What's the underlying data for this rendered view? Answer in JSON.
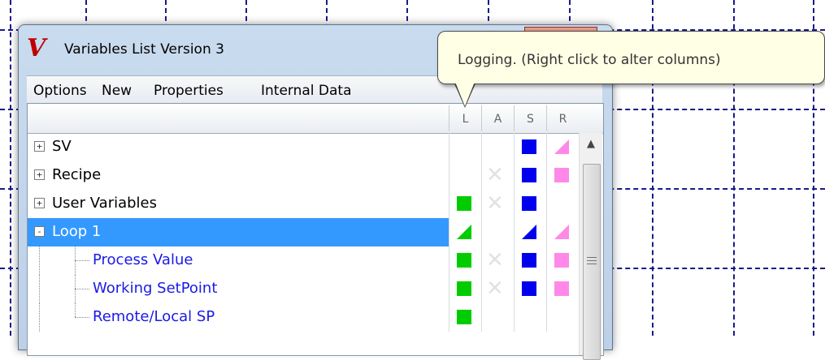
{
  "window": {
    "logo_glyph": "V",
    "title": "Variables List Version 3"
  },
  "menu": [
    "Options",
    "New",
    "Properties",
    "Internal Data"
  ],
  "columns": [
    "L",
    "A",
    "S",
    "R"
  ],
  "tooltip": "Logging. (Right click to alter columns)",
  "colors": {
    "green": "#00cc00",
    "blue": "#0000ee",
    "pink": "#ff88e8",
    "selection": "#3399ff",
    "child_text": "#1a1ae6"
  },
  "rows": [
    {
      "label": "SV",
      "level": 0,
      "expander": "+",
      "selected": false,
      "L": "none",
      "A": "none",
      "S": "blue",
      "R": "pink-tri"
    },
    {
      "label": "Recipe",
      "level": 0,
      "expander": "+",
      "selected": false,
      "L": "none",
      "A": "x",
      "S": "blue",
      "R": "pink"
    },
    {
      "label": "User Variables",
      "level": 0,
      "expander": "+",
      "selected": false,
      "L": "green",
      "A": "x",
      "S": "blue",
      "R": "none"
    },
    {
      "label": "Loop 1",
      "level": 0,
      "expander": "-",
      "selected": true,
      "L": "green-tri",
      "A": "none",
      "S": "blue-tri",
      "R": "pink-tri"
    },
    {
      "label": "Process Value",
      "level": 1,
      "expander": "",
      "selected": false,
      "L": "green",
      "A": "x",
      "S": "blue",
      "R": "pink"
    },
    {
      "label": "Working SetPoint",
      "level": 1,
      "expander": "",
      "selected": false,
      "L": "green",
      "A": "x",
      "S": "blue",
      "R": "pink"
    },
    {
      "label": "Remote/Local SP",
      "level": 1,
      "expander": "",
      "selected": false,
      "L": "green",
      "A": "none",
      "S": "none",
      "R": "none"
    }
  ]
}
